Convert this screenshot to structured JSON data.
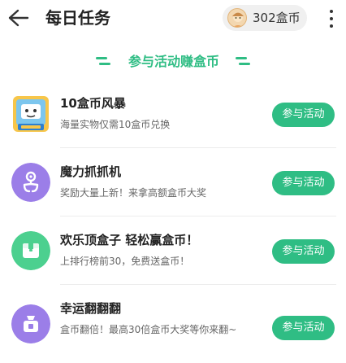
{
  "header": {
    "title": "每日任务",
    "coins": "302盒币",
    "back_icon": "back-arrow-icon",
    "more_icon": "more-vertical-icon"
  },
  "section": {
    "title": "参与活动赚盒币"
  },
  "tasks": [
    {
      "title": "10盒币风暴",
      "subtitle": "海量实物仅需10盒币兑换",
      "button": "参与活动",
      "icon": "storm-box-icon"
    },
    {
      "title": "魔力抓抓机",
      "subtitle": "奖励大量上新！来拿高额盒币大奖",
      "button": "参与活动",
      "icon": "claw-machine-icon"
    },
    {
      "title": "欢乐顶盒子 轻松赢盒币！",
      "subtitle": "上排行榜前30，免费送盒币！",
      "button": "参与活动",
      "icon": "box-icon"
    },
    {
      "title": "幸运翻翻翻",
      "subtitle": "盒币翻倍！最高30倍盒币大奖等你来翻~",
      "button": "参与活动",
      "icon": "lucky-bag-icon"
    }
  ],
  "colors": {
    "accent": "#2fbd84",
    "purple": "#9b7ee8",
    "green": "#4cd08f"
  }
}
